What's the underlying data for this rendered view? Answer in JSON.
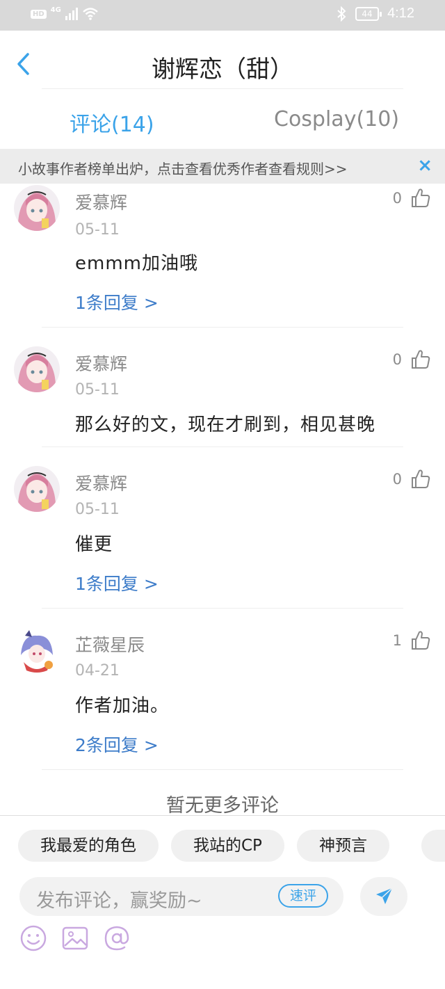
{
  "status_bar": {
    "hd": "HD",
    "network": "4G",
    "battery": "44",
    "time": "4:12"
  },
  "header": {
    "title": "谢辉恋（甜）"
  },
  "tabs": [
    {
      "label": "评论(14)",
      "active": true
    },
    {
      "label": "Cosplay(10)",
      "active": false
    }
  ],
  "banner": {
    "text": "小故事作者榜单出炉，点击查看优秀作者",
    "link": "查看规则>>",
    "close": "×"
  },
  "comments": [
    {
      "user": "爱慕辉",
      "date": "05-11",
      "text": "emmm加油哦",
      "likes": "0",
      "reply": "1条回复 >"
    },
    {
      "user": "爱慕辉",
      "date": "05-11",
      "text": "那么好的文，现在才刷到，相见甚晚",
      "likes": "0",
      "reply": ""
    },
    {
      "user": "爱慕辉",
      "date": "05-11",
      "text": "催更",
      "likes": "0",
      "reply": "1条回复 >"
    },
    {
      "user": "芷薇星辰",
      "date": "04-21",
      "text": "作者加油。",
      "likes": "1",
      "reply": "2条回复 >"
    }
  ],
  "no_more": "暂无更多评论",
  "bottom": {
    "chips": [
      "我最爱的角色",
      "我站的CP",
      "神预言"
    ],
    "input_placeholder": "发布评论，赢奖励~",
    "quick_label": "速评"
  },
  "colors": {
    "accent": "#3ba3e9",
    "reply_link": "#3d7cc9",
    "tool_icon": "#c9a8e0"
  },
  "icons": {
    "back": "chevron-left-icon",
    "like": "thumbs-up-icon",
    "send": "paper-plane-icon",
    "tools": [
      "smiley-icon",
      "image-icon",
      "at-icon"
    ]
  }
}
